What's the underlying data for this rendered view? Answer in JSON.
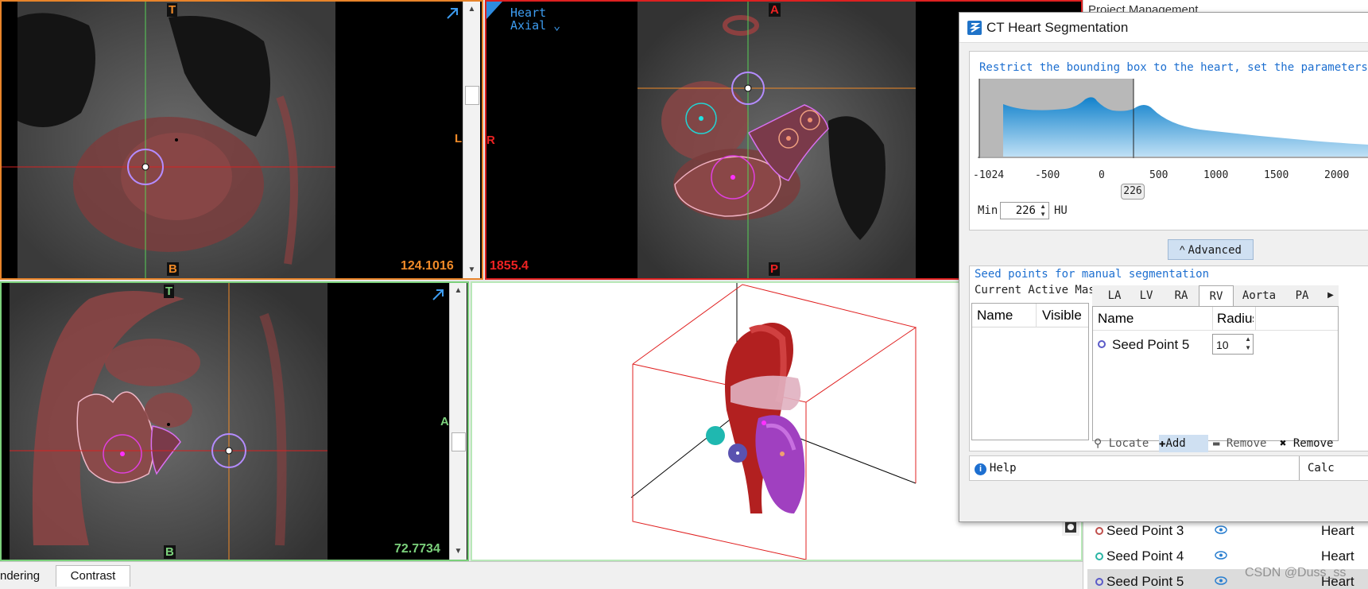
{
  "views": {
    "sagittal": {
      "top_label": "T",
      "bottom_label": "B",
      "right_label": "L",
      "scale": "124.1016"
    },
    "axial": {
      "view_name": "Heart",
      "view_mode": "Axial",
      "top_label": "A",
      "left_label": "R",
      "bottom_label": "P",
      "scale": "1855.4"
    },
    "coronal": {
      "top_label": "T",
      "bottom_label": "B",
      "right_label": "A",
      "scale": "72.7734"
    }
  },
  "bottom_tabs": [
    "ndering",
    "Contrast"
  ],
  "project_panel": {
    "title": "Project Management"
  },
  "dialog": {
    "title": "CT Heart Segmentation",
    "instruction": "Restrict the bounding box to the heart, set the parameters an",
    "histogram": {
      "axis_ticks": [
        "-1024",
        "-500",
        "0",
        "500",
        "1000",
        "1500",
        "2000"
      ],
      "threshold_marker": "226"
    },
    "min_label": "Min",
    "min_value": "226",
    "min_unit": "HU",
    "advanced_button": "Advanced",
    "seed_group_title": "Seed points for manual segmentation",
    "current_mask_label": "Current Active Mas",
    "mask_columns": [
      "Name",
      "Visible"
    ],
    "tabs": [
      "LA",
      "LV",
      "RA",
      "RV",
      "Aorta",
      "PA"
    ],
    "active_tab": "RV",
    "seed_columns": [
      "Name",
      "Radius"
    ],
    "seed_rows": [
      {
        "name": "Seed Point 5",
        "radius": "10"
      }
    ],
    "actions": {
      "locate": "Locate",
      "add": "Add",
      "remove": "Remove",
      "remove_all": "Remove a"
    },
    "help_label": "Help",
    "calc_label": "Calc"
  },
  "seed_list": [
    {
      "name": "Seed Point 3",
      "group": "Heart",
      "color": "#c0504d"
    },
    {
      "name": "Seed Point 4",
      "group": "Heart",
      "color": "#2ab5a5"
    },
    {
      "name": "Seed Point 5",
      "group": "Heart",
      "color": "#5a5ac8"
    }
  ],
  "watermark": "CSDN @Duss_ss"
}
